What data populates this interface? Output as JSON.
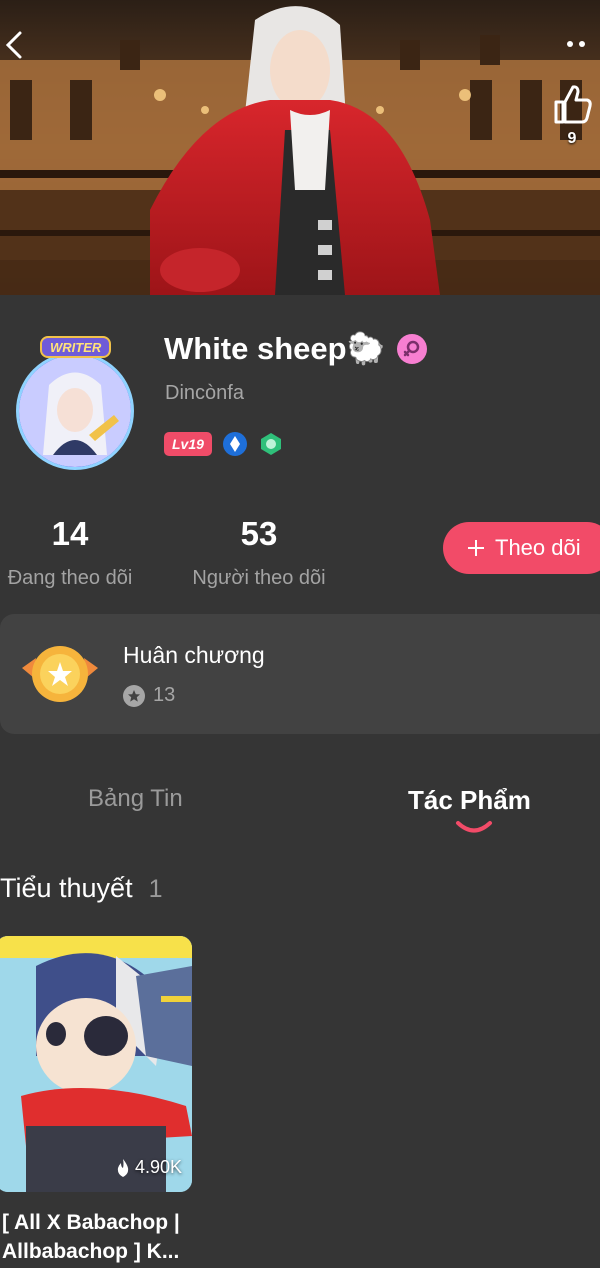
{
  "header": {
    "like_count": "9"
  },
  "profile": {
    "avatar_tag": "WRITER",
    "name": "White sheep🐑",
    "handle": "Dincònfa",
    "level_badge": "Lv19"
  },
  "stats": {
    "following_count": "14",
    "following_label": "Đang theo dõi",
    "followers_count": "53",
    "followers_label": "Người theo dõi",
    "follow_button": "Theo dõi"
  },
  "medals": {
    "title": "Huân chương",
    "count": "13"
  },
  "tabs": [
    {
      "label": "Bảng Tin",
      "active": false
    },
    {
      "label": "Tác Phẩm",
      "active": true
    }
  ],
  "section": {
    "title": "Tiểu thuyết",
    "count": "1"
  },
  "books": [
    {
      "title": "[ All X Babachop | Allbabachop ] K...",
      "heat": "4.90K"
    }
  ],
  "colors": {
    "background": "#353535",
    "accent": "#f24b68",
    "card": "#424242",
    "muted_text": "#a6a6a6"
  },
  "icons": {
    "back": "chevron-left-icon",
    "more": "more-dots-icon",
    "like": "thumbs-up-icon",
    "gender": "female-icon",
    "medal": "medal-icon",
    "heat": "fire-icon"
  }
}
